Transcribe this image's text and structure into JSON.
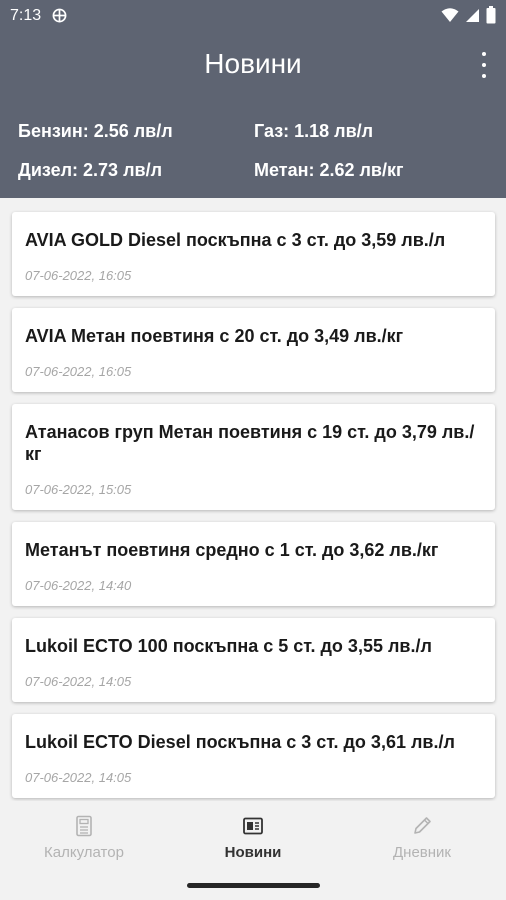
{
  "status_bar": {
    "time": "7:13",
    "icons": [
      "sync-icon",
      "wifi-icon",
      "signal-icon",
      "battery-icon"
    ]
  },
  "header": {
    "title": "Новини",
    "menu_icon": "more-vert-icon"
  },
  "prices": {
    "benzin": "Бензин: 2.56 лв/л",
    "gaz": "Газ: 1.18 лв/л",
    "dizel": "Дизел: 2.73 лв/л",
    "metan": "Метан: 2.62 лв/кг"
  },
  "news": [
    {
      "title": "AVIA GOLD Diesel поскъпна с 3 ст. до 3,59 лв./л",
      "date": "07-06-2022, 16:05"
    },
    {
      "title": "AVIA Метан поевтиня с 20 ст. до 3,49 лв./кг",
      "date": "07-06-2022, 16:05"
    },
    {
      "title": "Атанасов груп Метан поевтиня с 19 ст. до 3,79 лв./кг",
      "date": "07-06-2022, 15:05"
    },
    {
      "title": "Метанът поевтиня средно с 1 ст. до 3,62 лв./кг",
      "date": "07-06-2022, 14:40"
    },
    {
      "title": "Lukoil ECTO 100 поскъпна с 5 ст. до 3,55 лв./л",
      "date": "07-06-2022, 14:05"
    },
    {
      "title": "Lukoil ECTO Diesel поскъпна с 3 ст. до 3,61 лв./л",
      "date": "07-06-2022, 14:05"
    }
  ],
  "bottom_nav": {
    "calculator": {
      "label": "Калкулатор",
      "icon": "calculator-icon"
    },
    "news": {
      "label": "Новини",
      "icon": "newspaper-icon"
    },
    "diary": {
      "label": "Дневник",
      "icon": "pencil-icon"
    }
  },
  "colors": {
    "header_bg": "#5e6472",
    "page_bg": "#f2f2f2",
    "card_bg": "#ffffff",
    "active_nav": "#333333",
    "inactive_nav": "#b3b3b3"
  }
}
